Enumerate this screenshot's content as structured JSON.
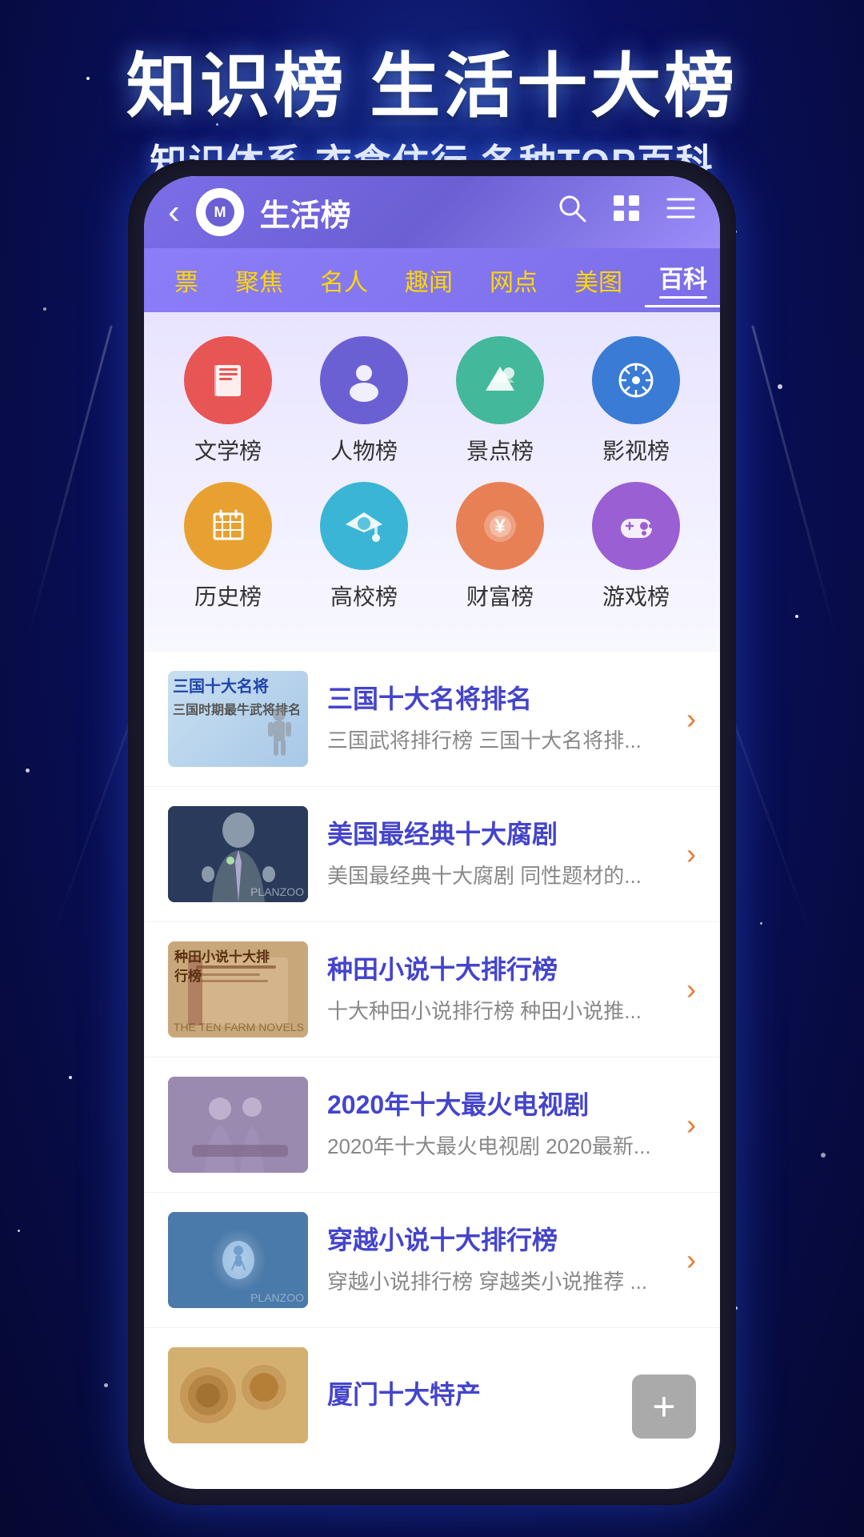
{
  "background": {
    "color": "#0a1060"
  },
  "hero": {
    "title_main": "知识榜 生活十大榜",
    "subtitle": "知识体系 衣食住行 各种TOP百科"
  },
  "nav": {
    "back_icon": "‹",
    "logo_text": "M",
    "title": "生活榜",
    "search_icon": "🔍",
    "grid_icon": "⊞",
    "list_icon": "≡"
  },
  "tabs": [
    {
      "label": "票",
      "active": false
    },
    {
      "label": "聚焦",
      "active": false
    },
    {
      "label": "名人",
      "active": false
    },
    {
      "label": "趣闻",
      "active": false
    },
    {
      "label": "网点",
      "active": false
    },
    {
      "label": "美图",
      "active": false
    },
    {
      "label": "百科",
      "active": true
    }
  ],
  "categories": [
    [
      {
        "label": "文学榜",
        "icon": "📖",
        "class": "cat-literature"
      },
      {
        "label": "人物榜",
        "icon": "👤",
        "class": "cat-people"
      },
      {
        "label": "景点榜",
        "icon": "🏔",
        "class": "cat-scenery"
      },
      {
        "label": "影视榜",
        "icon": "🎬",
        "class": "cat-film"
      }
    ],
    [
      {
        "label": "历史榜",
        "icon": "📋",
        "class": "cat-history"
      },
      {
        "label": "高校榜",
        "icon": "🎓",
        "class": "cat-university"
      },
      {
        "label": "财富榜",
        "icon": "💰",
        "class": "cat-wealth"
      },
      {
        "label": "游戏榜",
        "icon": "🎮",
        "class": "cat-game"
      }
    ]
  ],
  "list_items": [
    {
      "title": "三国十大名将排名",
      "desc": "三国武将排行榜 三国十大名将排...",
      "thumb_class": "thumb-1",
      "thumb_text": "三国十大名将\n三国时期最牛武将排名"
    },
    {
      "title": "美国最经典十大腐剧",
      "desc": "美国最经典十大腐剧 同性题材的...",
      "thumb_class": "thumb-2",
      "thumb_text": ""
    },
    {
      "title": "种田小说十大排行榜",
      "desc": "十大种田小说排行榜 种田小说推...",
      "thumb_class": "thumb-3",
      "thumb_text": "种田小说十大排行榜"
    },
    {
      "title": "2020年十大最火电视剧",
      "desc": "2020年十大最火电视剧 2020最新...",
      "thumb_class": "thumb-4",
      "thumb_text": ""
    },
    {
      "title": "穿越小说十大排行榜",
      "desc": "穿越小说排行榜 穿越类小说推荐 ...",
      "thumb_class": "thumb-5",
      "thumb_text": ""
    },
    {
      "title": "厦门十大特产",
      "desc": "",
      "thumb_class": "thumb-6",
      "thumb_text": ""
    }
  ],
  "fab": {
    "icon": "+"
  }
}
